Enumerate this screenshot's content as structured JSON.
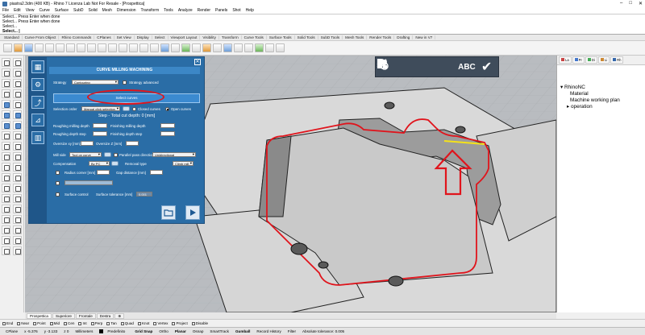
{
  "window": {
    "title": "piastra2.3dm (400 KB) - Rhino 7 Licenza Lab Not For Resale - [Prospettica]",
    "controls": [
      "–",
      "□",
      "✕"
    ]
  },
  "menu": [
    "File",
    "Edit",
    "View",
    "Curve",
    "Surface",
    "SubD",
    "Solid",
    "Mesh",
    "Dimension",
    "Transform",
    "Tools",
    "Analyze",
    "Render",
    "Panels",
    "Shot",
    "Help"
  ],
  "command_history": [
    "Select... Press Enter when done",
    "Select... Press Enter when done",
    "Select..."
  ],
  "command_prompt": "Select... |",
  "toolbar_tabs": [
    "Standard",
    "Curve From Object",
    "Rhino Commands",
    "CPlanes",
    "Set View",
    "Display",
    "Select",
    "Viewport Layout",
    "Visibility",
    "Transform",
    "Curve Tools",
    "Surface Tools",
    "Solid Tools",
    "SubD Tools",
    "Mesh Tools",
    "Render Tools",
    "Drafting",
    "New in V7"
  ],
  "viewport_toolbar": {
    "abc_label": "ABC",
    "check_label": "✔"
  },
  "panel": {
    "title": "CURVE MILLING MACHINING",
    "close": "✕",
    "strategy_label": "Strategy",
    "strategy_value": "Contouring",
    "strategy_advanced": "Strategy advanced",
    "select_curves": "Select curves",
    "selection_order_label": "Selection order",
    "selection_order_value": "Manual click selection",
    "closed_curves": "Closed curves",
    "open_curves": "Open curves",
    "step_title": "Step - Total cut depth: 0 [mm]",
    "roughing_milling_depth": "Roughing milling depth",
    "finishing_milling_depth": "Finishing milling depth",
    "roughing_depth_step": "Roughing depth step",
    "finishing_depth_step": "Finishing depth step",
    "oversize_xy": "Oversize xy [mm]",
    "oversize_z": "Oversize Z [mm]",
    "mill_side_label": "Mill side",
    "mill_side_value": "Tool on curve",
    "parallel_pass_label": "Parallel pass direction",
    "parallel_pass_value": "Unidirectional",
    "compensation_label": "Compensation",
    "compensation_value": "By PC",
    "removal_type_label": "Removal type",
    "removal_type_value": "Climb mill",
    "radius_corner": "Radius corner [mm]",
    "gap_distance": "Gap distance [mm]",
    "surface_control": "Surface control",
    "surface_tolerance_label": "Surface tolerance [mm]",
    "surface_tolerance_value": "0.001"
  },
  "right_panel": {
    "tabs": [
      "La",
      "Pr",
      "Di",
      "Li",
      "Rh"
    ],
    "tree_root": "RhinoNC",
    "tree_items": [
      "Material",
      "Machine working plan",
      "operation"
    ]
  },
  "view_tabs": [
    "Prospettica",
    "Superiore",
    "Frontale",
    "Destra",
    "⊕"
  ],
  "osnaps": [
    "End",
    "Near",
    "Point",
    "Mid",
    "Cen",
    "Int",
    "Perp",
    "Tan",
    "Quad",
    "Knot",
    "Vertex",
    "Project",
    "Disable"
  ],
  "status": {
    "cplane": "CPlane",
    "x": "x -5.376",
    "y": "y -3.133",
    "z": "z 0",
    "units": "Millimeters",
    "layer": "Predefinito",
    "toggles": [
      "Grid Snap",
      "Ortho",
      "Planar",
      "Osnap",
      "SmartTrack",
      "Gumball",
      "Record History",
      "Filter"
    ],
    "tolerance": "Absolute tolerance: 0.005"
  },
  "colors": {
    "panel_bg": "#2a6da6",
    "viewport_bg": "#b9bcc0",
    "path_red": "#e0141c",
    "highlight_yellow": "#f4e11a"
  }
}
